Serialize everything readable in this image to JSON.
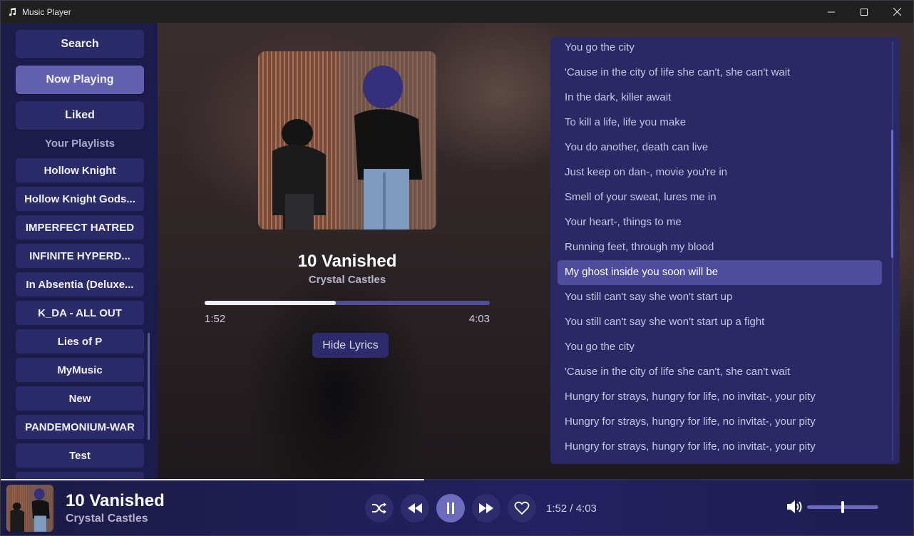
{
  "window": {
    "title": "Music Player",
    "icon": "music-note-icon"
  },
  "sidebar": {
    "search_label": "Search",
    "now_playing_label": "Now Playing",
    "liked_label": "Liked",
    "playlists_heading": "Your Playlists",
    "playlists": [
      "Hollow Knight",
      "Hollow Knight Gods...",
      "IMPERFECT HATRED",
      "INFINITE HYPERD...",
      "In Absentia (Deluxe...",
      "K_DA - ALL OUT",
      "Lies of P",
      "MyMusic",
      "New",
      "PANDEMONIUM-WAR",
      "Test",
      ""
    ]
  },
  "now_playing": {
    "title": "10 Vanished",
    "artist": "Crystal Castles",
    "current_time": "1:52",
    "total_time": "4:03",
    "progress_fraction": 0.46,
    "hide_lyrics_label": "Hide Lyrics"
  },
  "lyrics": {
    "current_index": 9,
    "lines": [
      "You go the city",
      "'Cause in the city of life she can't, she can't wait",
      "In the dark, killer await",
      "To kill a life, life you make",
      "You do another, death can live",
      "Just keep on dan-, movie you're in",
      "Smell of your sweat, lures me in",
      "Your heart-, things to me",
      "Running feet, through my blood",
      "My ghost inside you soon will be",
      "You still can't say she won't start up",
      "You still can't say she won't start up a fight",
      "You go the city",
      "'Cause in the city of life she can't, she can't wait",
      "Hungry for strays, hungry for life, no invitat-, your pity",
      "Hungry for strays, hungry for life, no invitat-, your pity",
      "Hungry for strays, hungry for life, no invitat-, your pity",
      "Hungry for strays, hungry for life, no invitat-, your pity"
    ]
  },
  "player": {
    "title": "10 Vanished",
    "artist": "Crystal Castles",
    "time_display": "1:52 / 4:03",
    "volume_fraction": 0.5
  },
  "colors": {
    "accent": "#6e6bbf",
    "sidebar_bg": "#1b1c4a",
    "button_bg": "#2c2b6a",
    "lyrics_bg": "#2a2865",
    "lyric_highlight": "#4f4c9c"
  }
}
